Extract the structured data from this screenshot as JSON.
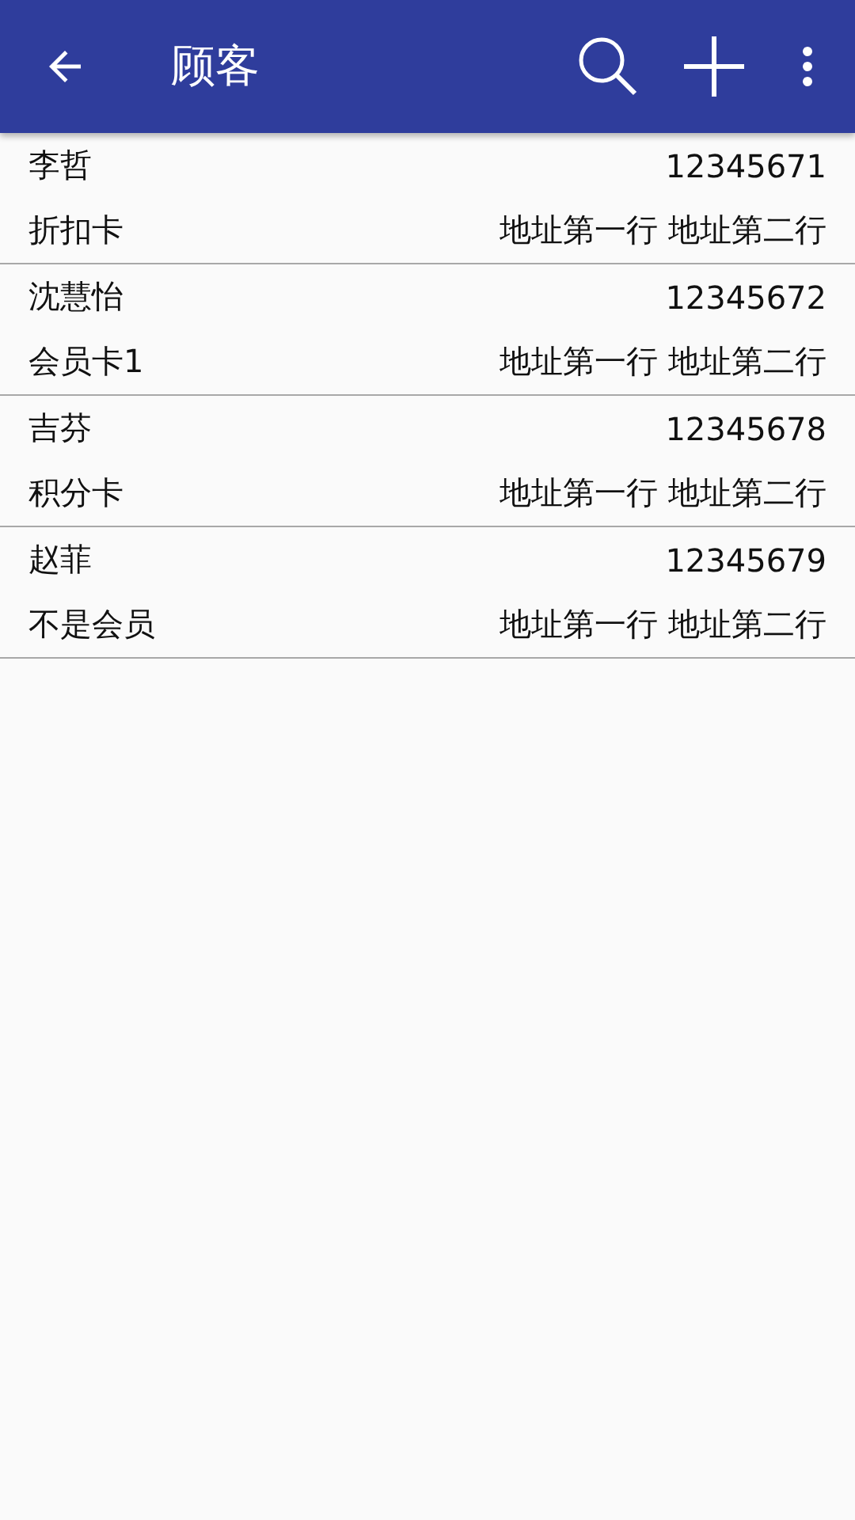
{
  "app_bar": {
    "title": "顾客"
  },
  "customers": [
    {
      "name": "李哲",
      "phone": "12345671",
      "card": "折扣卡",
      "address": "地址第一行 地址第二行"
    },
    {
      "name": "沈慧怡",
      "phone": "12345672",
      "card": "会员卡1",
      "address": "地址第一行 地址第二行"
    },
    {
      "name": "吉芬",
      "phone": "12345678",
      "card": "积分卡",
      "address": "地址第一行 地址第二行"
    },
    {
      "name": "赵菲",
      "phone": "12345679",
      "card": "不是会员",
      "address": "地址第一行 地址第二行"
    }
  ]
}
